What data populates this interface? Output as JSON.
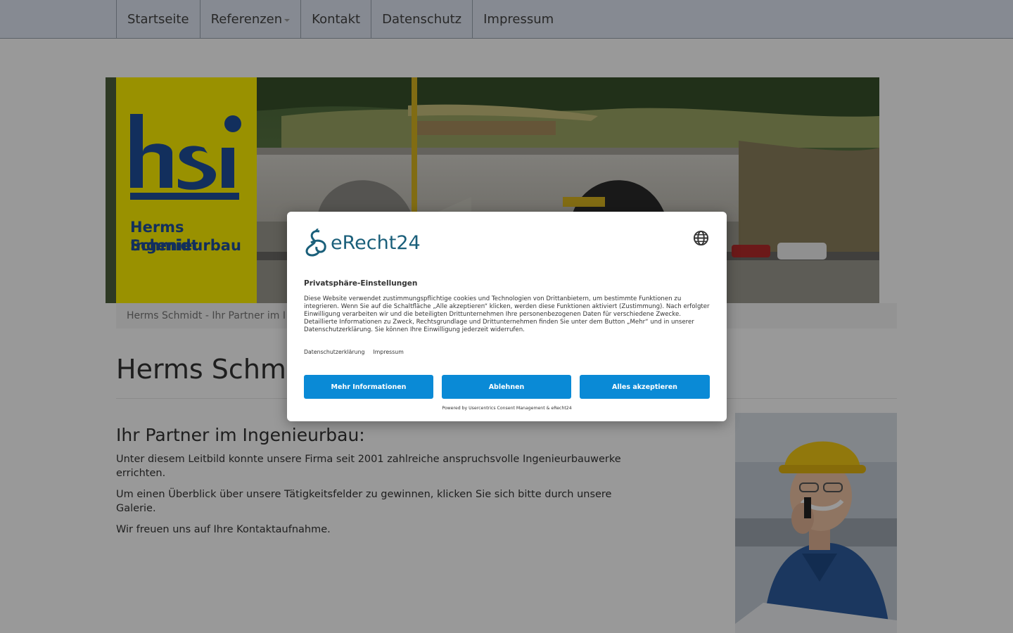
{
  "nav": {
    "items": [
      {
        "label": "Startseite"
      },
      {
        "label": "Referenzen",
        "dropdown": true
      },
      {
        "label": "Kontakt"
      },
      {
        "label": "Datenschutz"
      },
      {
        "label": "Impressum"
      }
    ]
  },
  "logo": {
    "mark": "hsi",
    "line1": "Herms Schmidt",
    "line2": "Ingenieurbau",
    "color": "#1e4f9c",
    "background": "#fff200"
  },
  "breadcrumb": "Herms Schmidt - Ihr Partner im I",
  "page_title": "Herms Schmic",
  "content": {
    "subheading": "Ihr Partner im Ingenieurbau:",
    "paragraphs": [
      "Unter diesem Leitbild konnte unsere Firma seit 2001 zahlreiche anspruchsvolle Ingenieurbauwerke errichten.",
      "Um einen Überblick über unsere Tätigkeitsfelder zu gewinnen, klicken Sie sich bitte durch unsere Galerie.",
      "Wir freuen uns auf Ihre Kontaktaufnahme."
    ]
  },
  "consent": {
    "brand": "eRecht24",
    "title": "Privatsphäre-Einstellungen",
    "body": "Diese Website verwendet zustimmungspflichtige cookies und Technologien von Drittanbietern, um bestimmte Funktionen zu integrieren. Wenn Sie auf die Schaltfläche „Alle akzeptieren“ klicken, werden diese Funktionen aktiviert (Zustimmung). Nach erfolgter Einwilligung verarbeiten wir und die beteiligten Drittunternehmen Ihre personenbezogenen Daten für verschiedene Zwecke. Detaillierte Informationen zu Zweck, Rechtsgrundlage und Drittunternehmen finden Sie unter dem Button „Mehr“ und in unserer Datenschutzerklärung. Sie können Ihre Einwilligung jederzeit widerrufen.",
    "links": [
      "Datenschutzerklärung",
      "Impressum"
    ],
    "buttons": {
      "more": "Mehr Informationen",
      "deny": "Ablehnen",
      "accept": "Alles akzeptieren"
    },
    "powered_by": "Powered by Usercentrics Consent Management & eRecht24",
    "accent_color": "#0a8ad6"
  },
  "icons": {
    "globe": "globe-icon",
    "logo": "erecht24-logo-icon",
    "caret": "chevron-down-icon"
  }
}
